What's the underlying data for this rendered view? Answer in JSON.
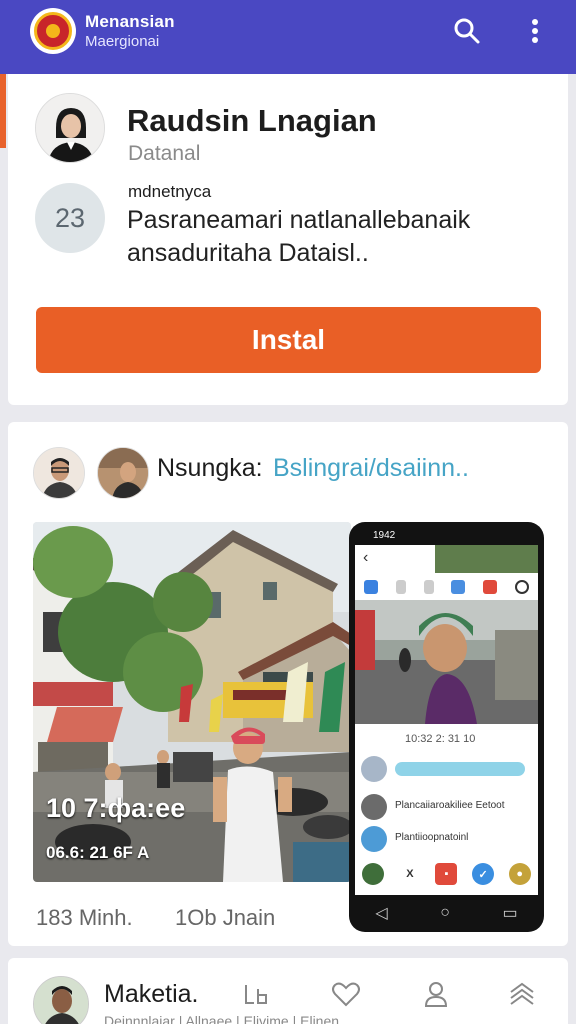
{
  "appbar": {
    "title": "Menansian",
    "subtitle": "Maergionai",
    "brand_color": "#4a48c2"
  },
  "profile": {
    "name": "Raudsin Lnagian",
    "subtitle": "Datanal",
    "badge_number": "23",
    "small_label": "mdnetnyca",
    "description": "Pasraneamari natlanallebanaik ansaduritaha Dataisl..",
    "install_label": "Instal",
    "install_color": "#e95f26"
  },
  "post": {
    "author": "Nsungka:",
    "link_text": "Bslingrai/dsaiinn..",
    "photo_time": "10 7:фa:ee",
    "photo_date": "06.6: 21 6F  A",
    "phone_status_time": "1942",
    "phone_meta": "10:32 2: 31 10",
    "phone_rows": [
      {
        "text": ""
      },
      {
        "text": "Plancaiiaroakiliee Eetoot"
      },
      {
        "text": "Plantiioopnatoinl"
      }
    ],
    "phone_actions": [
      "X",
      "▪",
      "✓",
      "●"
    ],
    "stats": [
      {
        "label": "183 Minh."
      },
      {
        "label": "1Ob Jnain"
      }
    ]
  },
  "bottom_card": {
    "name": "Maketia.",
    "cut_text": "Deinnnlaiar | Allnaee | Elivime | Elinen"
  },
  "icons": {
    "search": "search-icon",
    "more": "more-vertical-icon",
    "bottom_actions": [
      "chart-icon",
      "heart-icon",
      "user-icon",
      "layers-icon"
    ]
  }
}
